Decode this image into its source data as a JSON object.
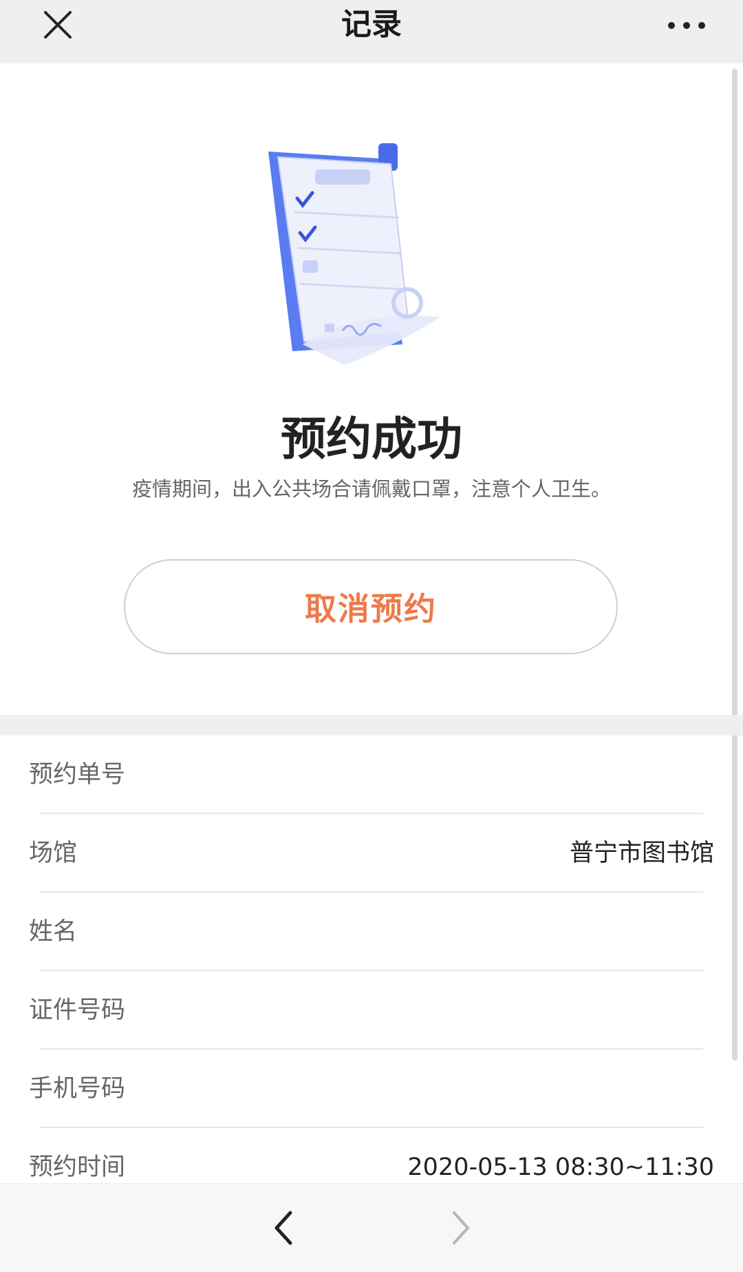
{
  "header": {
    "title": "记录",
    "close_icon": "close-icon",
    "more_icon": "more-icon"
  },
  "hero": {
    "illustration_icon": "document-checklist-illustration",
    "title": "预约成功",
    "notice": "疫情期间，出入公共场合请佩戴口罩，注意个人卫生。",
    "cancel_label": "取消预约",
    "cancel_color": "#ee7a4b"
  },
  "details": {
    "rows": [
      {
        "label": "预约单号",
        "value": ""
      },
      {
        "label": "场馆",
        "value": "普宁市图书馆"
      },
      {
        "label": "姓名",
        "value": ""
      },
      {
        "label": "证件号码",
        "value": ""
      },
      {
        "label": "手机号码",
        "value": ""
      },
      {
        "label": "预约时间",
        "value": "2020-05-13 08:30~11:30"
      }
    ]
  },
  "nav": {
    "back_icon": "chevron-left-icon",
    "forward_icon": "chevron-right-icon"
  }
}
